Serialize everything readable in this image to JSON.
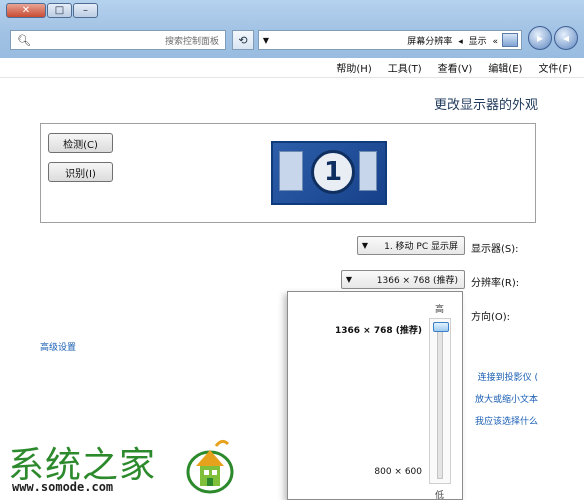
{
  "window": {
    "controls": [
      "✕",
      "□",
      "–"
    ]
  },
  "search": {
    "placeholder": "搜索控制面板"
  },
  "address": {
    "crumbs": [
      "屏幕分辨率",
      "显示"
    ]
  },
  "menu": [
    "文件(F)",
    "编辑(E)",
    "查看(V)",
    "工具(T)",
    "帮助(H)"
  ],
  "page": {
    "heading": "更改显示器的外观",
    "detect_label": "检测(C)",
    "identify_label": "识别(I)",
    "monitor_number": "1",
    "display_label": "显示器(S):",
    "display_value": "1. 移动 PC 显示屏",
    "resolution_label": "分辨率(R):",
    "resolution_value": "1366 × 768 (推荐)",
    "orientation_label": "方向(O):",
    "advanced_link": "高级设置",
    "links": [
      "连接到投影仪 (",
      "放大或缩小文本",
      "我应该选择什么"
    ]
  },
  "popup": {
    "high_label": "高",
    "low_label": "低",
    "current": "1366 × 768 (推荐)",
    "minimum": "800 × 600",
    "slider_level": 1.0
  },
  "watermark": {
    "text": "系统之家",
    "url": "www.somode.com"
  },
  "colors": {
    "link": "#1a5fb4",
    "heading": "#1e395b",
    "watermark_green": "#2c8a2c"
  }
}
